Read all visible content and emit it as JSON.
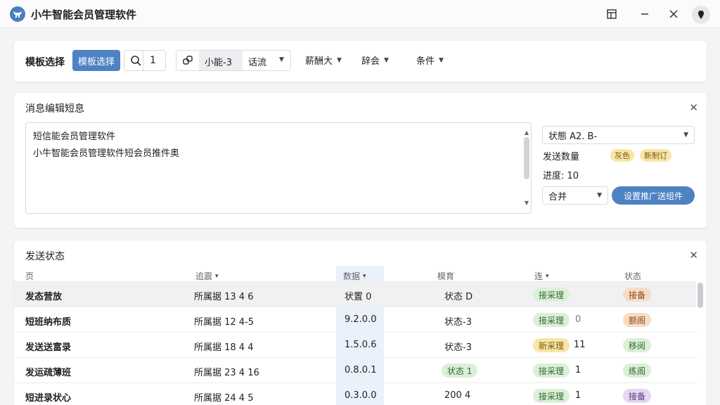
{
  "app": {
    "title": "小牛智能会员管理软件",
    "icon": "bull-logo-icon",
    "accent": "#4d82c3"
  },
  "toolbar": {
    "label": "模板选择",
    "primary_button": "模板选择",
    "search_value": "1",
    "segment_value": "小能-3",
    "flow_select": "话流",
    "drop1": "薪酬大",
    "drop2": "辞会",
    "drop3": "条件"
  },
  "message": {
    "title": "消息编辑短息",
    "line1": "短信能会员管理软件",
    "line2": "小牛智能会员管理软件短会员推件奥",
    "status_select": "状態 A2. B-",
    "send_count_label": "发送数量",
    "tag1": "灰色",
    "tag2": "新制订",
    "progress_text": "进度: 10",
    "combine_select": "合并",
    "send_button": "设置推广送组件"
  },
  "status": {
    "title": "发送状态",
    "headers": [
      "页",
      "追震",
      "数据",
      "模育",
      "连",
      "状态"
    ],
    "rows": [
      {
        "name": "发态营放",
        "code": "所属据 13 4 6",
        "value": "状置 0",
        "state": "状态 D",
        "tag": "接采理",
        "num": "",
        "status": "接备"
      },
      {
        "name": "短班纳布质",
        "code": "所属据 12 4-5",
        "value": "9.2.0.0",
        "state": "状态-3",
        "tag": "接采理",
        "num": "0",
        "status": "额阁"
      },
      {
        "name": "发送送富录",
        "code": "所属据 18 4 4",
        "value": "1.5.0.6",
        "state": "状态-3",
        "tag": "新采理",
        "num": "11",
        "status": "移阅"
      },
      {
        "name": "发运疏薄班",
        "code": "所属据 23 4 16",
        "value": "0.8.0.1",
        "state": "状态 1",
        "tag": "接采理",
        "num": "1",
        "status": "练阁"
      },
      {
        "name": "短进录状心",
        "code": "所属据 24 4 5",
        "value": "0.3.0.0",
        "state": "200 4",
        "tag": "接采理",
        "num": "1",
        "status": "接备"
      }
    ]
  },
  "colors": {
    "tag_green_bg": "#dcefd8",
    "tag_yellow_bg": "#f7e6a8",
    "tag_orange_bg": "#f7dcc4",
    "tag_purple_bg": "#e6d6f2"
  }
}
